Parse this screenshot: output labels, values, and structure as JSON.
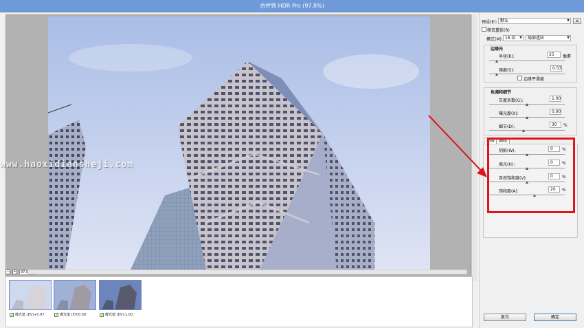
{
  "window": {
    "title": "合并到 HDR Pro (97.8%)"
  },
  "watermark": {
    "text": "www.haoxidiansheji.com"
  },
  "status": {
    "zoom": "97.8%",
    "minus": "−",
    "plus": "+"
  },
  "filmstrip": {
    "items": [
      {
        "label": "曝光值 (EV)+0.97",
        "checked": "✓"
      },
      {
        "label": "曝光值 (EV)0.00",
        "checked": "✓"
      },
      {
        "label": "曝光值 (EV)-1.00",
        "checked": "✓"
      }
    ]
  },
  "panel": {
    "preset": {
      "label": "预设(E):",
      "value": "默认"
    },
    "remove_ghosts": {
      "label": "移去重影(R)"
    },
    "mode": {
      "label": "模式(M):",
      "value": "16 位",
      "method": "局部适应"
    },
    "edge_glow": {
      "title": "边缘光",
      "radius": {
        "label": "半径(R):",
        "value": "25",
        "unit": "像素",
        "level": 0.1
      },
      "strength": {
        "label": "强度(S):",
        "value": "0.53",
        "level": 0.1
      },
      "smooth_edges": {
        "label": "边缘平滑度"
      }
    },
    "tone_detail": {
      "title": "色调和细节",
      "gamma": {
        "label": "灰度系数(G):",
        "value": "1.00",
        "level": 0.5
      },
      "exposure": {
        "label": "曝光度(X):",
        "value": "0.00",
        "level": 0.5
      },
      "detail": {
        "label": "细节(D):",
        "value": "30",
        "unit": "%",
        "level": 0.45
      }
    },
    "tabs": {
      "advanced": "高级",
      "curve": "曲线"
    },
    "advanced": {
      "shadow": {
        "label": "阴影(W):",
        "value": "0",
        "unit": "%",
        "level": 0.5
      },
      "highlight": {
        "label": "高光(H):",
        "value": "0",
        "unit": "%",
        "level": 0.5
      },
      "vibrance": {
        "label": "自然饱和度(V):",
        "value": "0",
        "unit": "%",
        "level": 0.5
      },
      "saturation": {
        "label": "饱和度(A):",
        "value": "20",
        "unit": "%",
        "level": 0.6
      }
    },
    "buttons": {
      "reset": "复位",
      "ok": "确定"
    }
  },
  "colors": {
    "annotation_red": "#e0151b",
    "titlebar": "#6f9ad9"
  }
}
